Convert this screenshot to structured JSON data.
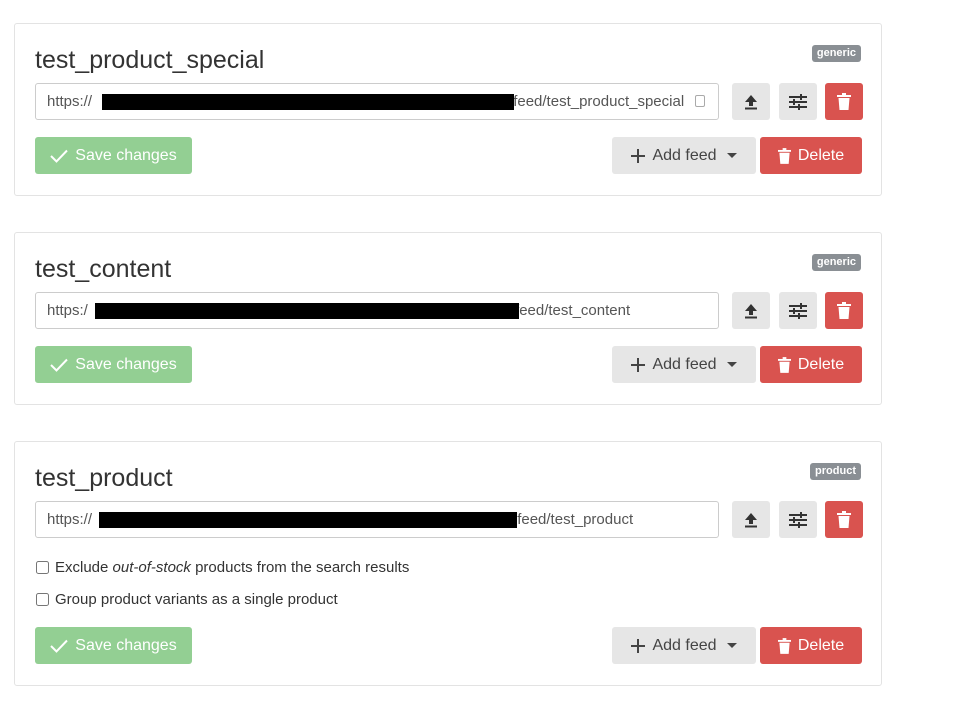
{
  "feeds": [
    {
      "title": "test_product_special",
      "badge": "generic",
      "url_prefix": "https://",
      "url_suffix": "/feed/test_product_special",
      "save_label": "Save changes",
      "add_feed_label": "Add feed",
      "delete_label": "Delete"
    },
    {
      "title": "test_content",
      "badge": "generic",
      "url_prefix": "https:/",
      "url_suffix": "/feed/test_content",
      "save_label": "Save changes",
      "add_feed_label": "Add feed",
      "delete_label": "Delete"
    },
    {
      "title": "test_product",
      "badge": "product",
      "url_prefix": "https://",
      "url_suffix": "/feed/test_product",
      "save_label": "Save changes",
      "add_feed_label": "Add feed",
      "delete_label": "Delete",
      "options": [
        {
          "before": "Exclude ",
          "emphasis": "out-of-stock",
          "after": " products from the search results",
          "checked": false
        },
        {
          "before": "Group product variants as a single product",
          "emphasis": "",
          "after": "",
          "checked": false
        }
      ]
    }
  ],
  "icons": {
    "upload": "upload-icon",
    "settings": "sliders-icon",
    "trash": "trash-icon",
    "check": "check-icon",
    "plus": "plus-icon",
    "caret": "caret-down-icon"
  },
  "colors": {
    "save": "#93cf93",
    "danger": "#d9534f",
    "neutral": "#e6e6e6",
    "badge": "#8a8f94"
  }
}
